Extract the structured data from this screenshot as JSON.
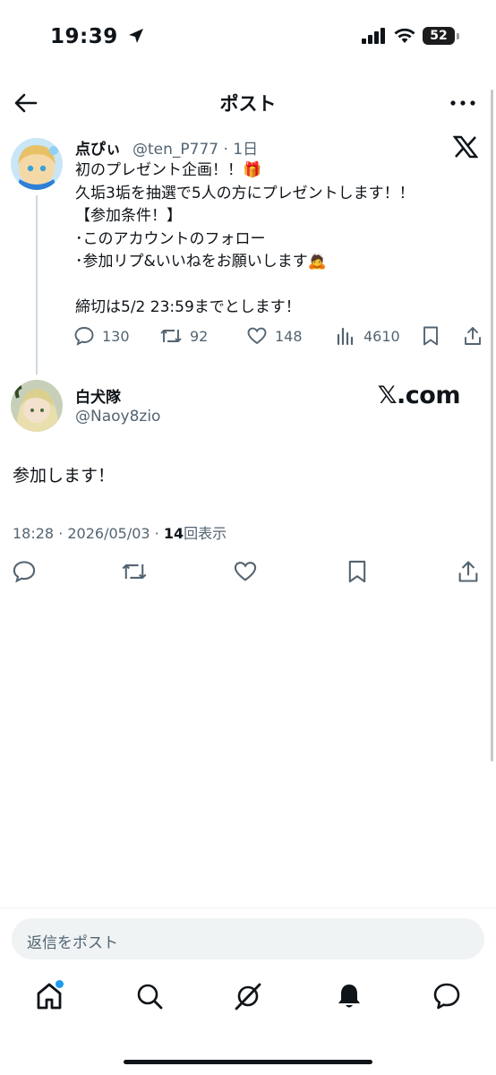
{
  "status_bar": {
    "time": "19:39",
    "battery": "52"
  },
  "header": {
    "title": "ポスト"
  },
  "quoted_tweet": {
    "name": "点ぴぃ",
    "handle": "@ten_P777 · 1日",
    "body": "初のプレゼント企画！！🎁\n久垢3垢を抽選で5人の方にプレゼントします！！\n【参加条件！】\n･このアカウントのフォロー\n･参加リプ&いいねをお願いします🙇\n\n締切は5/2 23:59までとします！",
    "stats": {
      "replies": "130",
      "reposts": "92",
      "likes": "148",
      "views": "4610"
    }
  },
  "reply_tweet": {
    "name": "白犬隊",
    "handle": "@Naoy8zio",
    "watermark": "𝕏.com",
    "body": "参加します！",
    "meta_time": "18:28 · 2026/05/03 · ",
    "meta_views": "14",
    "meta_views_label": "回表示"
  },
  "reply_input": {
    "placeholder": "返信をポスト"
  },
  "tabs": [
    "home",
    "search",
    "grok",
    "notifications",
    "messages"
  ],
  "colors": {
    "accent": "#1d9bf0",
    "text": "#0f1419",
    "secondary": "#536471"
  }
}
